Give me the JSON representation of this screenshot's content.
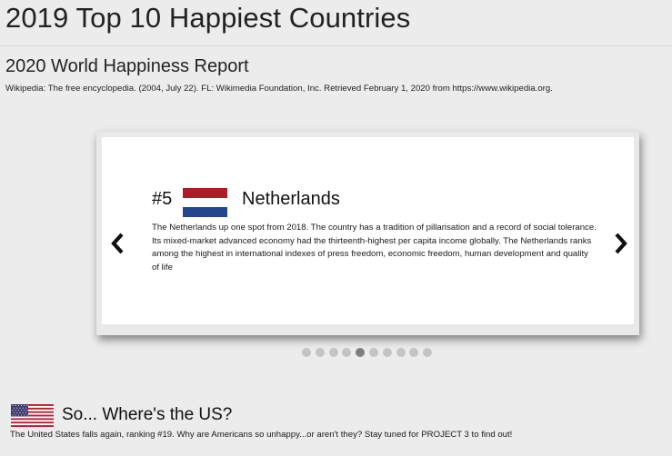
{
  "page": {
    "title": "2019 Top 10 Happiest Countries"
  },
  "report": {
    "title": "2020 World Happiness Report",
    "citation": "Wikipedia: The free encyclopedia. (2004, July 22). FL: Wikimedia Foundation, Inc. Retrieved February 1, 2020 from https://www.wikipedia.org."
  },
  "carousel": {
    "current_slide": {
      "rank": "#5",
      "country": "Netherlands",
      "flag_icon": "netherlands-flag-icon",
      "flag_colors": [
        "#ae1c28",
        "#ffffff",
        "#21468b"
      ],
      "description": "The Netherlands up one spot from 2018. The country has a tradition of pillarisation and a record of social tolerance. Its mixed-market advanced economy had the thirteenth-highest per capita income globally. The Netherlands ranks among the highest in international indexes of press freedom, economic freedom, human development and quality of life"
    },
    "prev_icon": "chevron-left-icon",
    "next_icon": "chevron-right-icon",
    "slide_count": 10,
    "active_index": 4,
    "dot_color": "#c4c4c4",
    "dot_active_color": "#7d7d7d"
  },
  "us_section": {
    "flag_icon": "usa-flag-icon",
    "heading": "So... Where's the US?",
    "text": "The United States falls again, ranking #19. Why are Americans so unhappy...or aren't they? Stay tuned for PROJECT 3 to find out!"
  }
}
